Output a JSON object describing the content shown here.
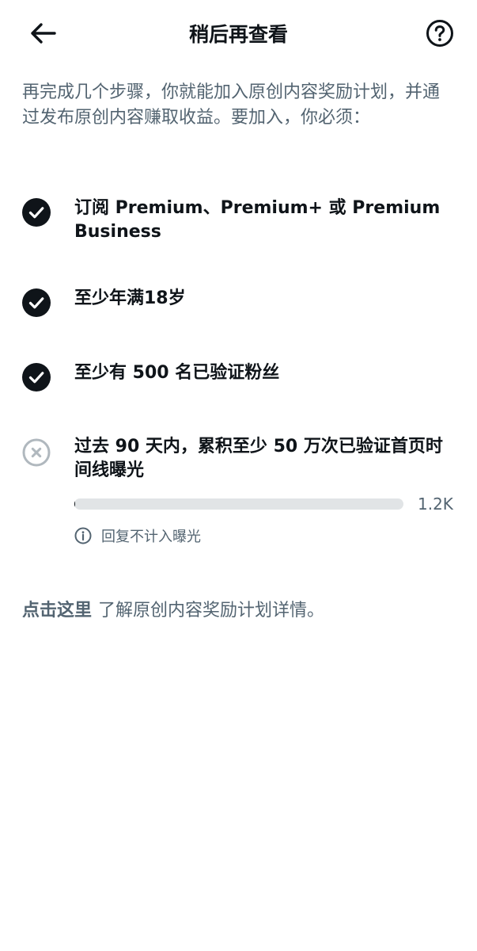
{
  "header": {
    "title": "稍后再查看",
    "back_icon": "arrow-left-icon",
    "help_icon": "question-circle-icon"
  },
  "intro": "再完成几个步骤，你就能加入原创内容奖励计划，并通过发布原创内容赚取收益。要加入，你必须：",
  "requirements": [
    {
      "label": "订阅 Premium、Premium+ 或 Premium Business",
      "met": true,
      "icon": "check-circle-icon"
    },
    {
      "label": "至少年满18岁",
      "met": true,
      "icon": "check-circle-icon"
    },
    {
      "label": "至少有 500 名已验证粉丝",
      "met": true,
      "icon": "check-circle-icon"
    },
    {
      "label": "过去 90 天内，累积至少 50 万次已验证首页时间线曝光",
      "met": false,
      "icon": "x-circle-icon"
    }
  ],
  "progress": {
    "value_label": "1.2K",
    "fraction": 0.0024
  },
  "note": {
    "text": "回复不计入曝光",
    "icon": "info-circle-icon"
  },
  "footer": {
    "link_text": "点击这里",
    "rest_text": "了解原创内容奖励计划详情。"
  },
  "colors": {
    "primary_text": "#0f1419",
    "secondary_text": "#536471",
    "track": "#e1e4e6",
    "unmet_icon": "#b0b8be"
  }
}
